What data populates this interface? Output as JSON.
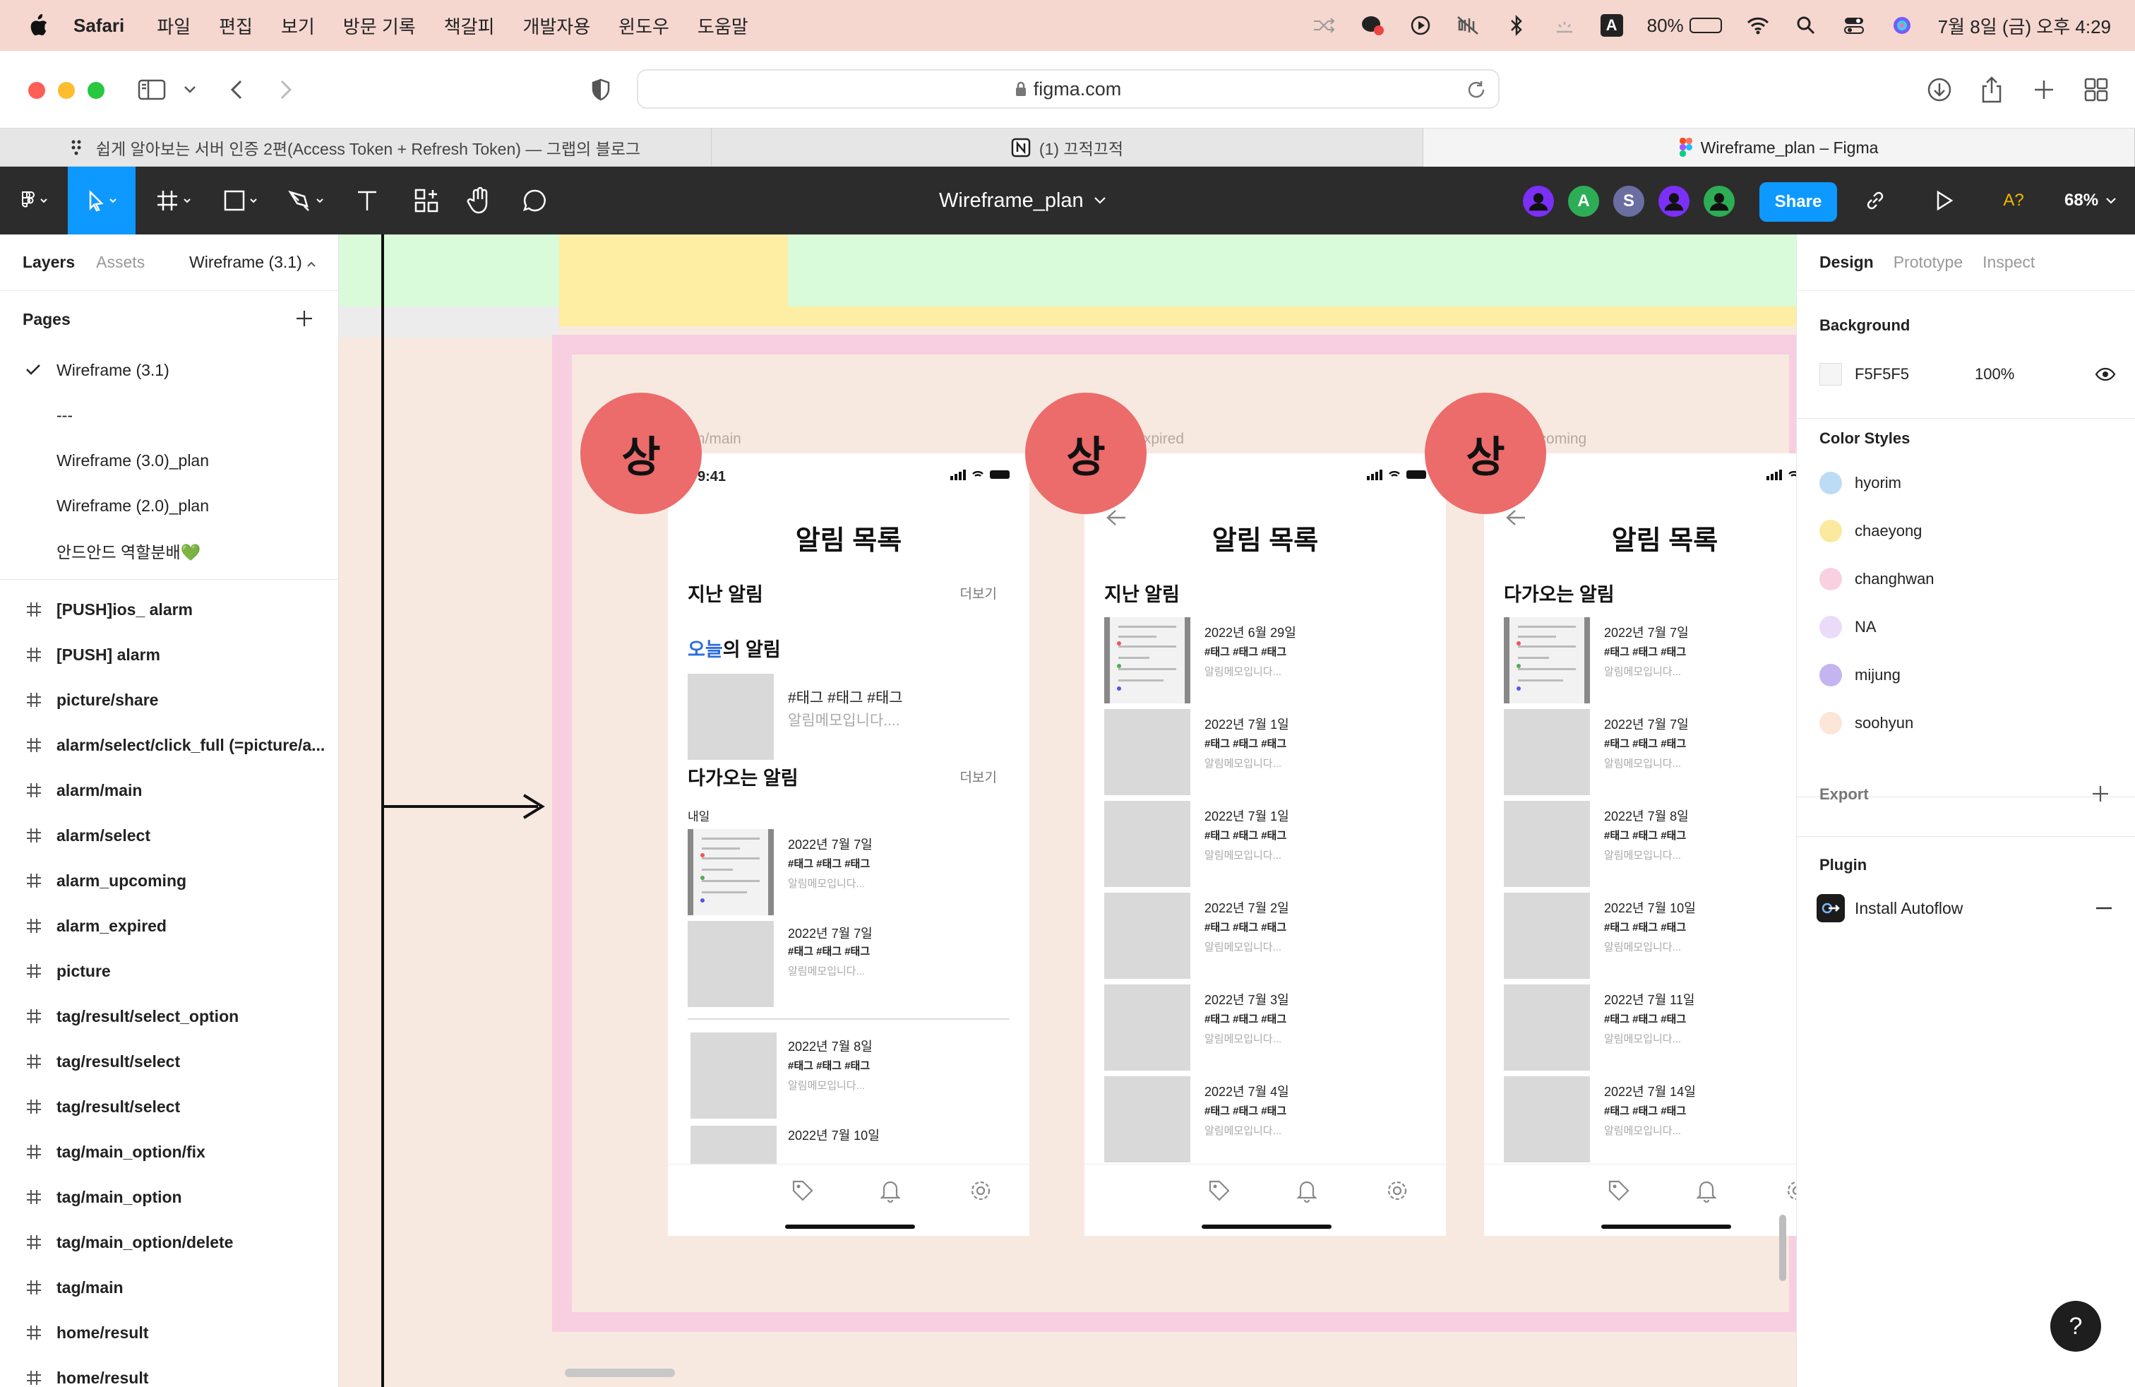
{
  "menubar": {
    "app_name": "Safari",
    "items": [
      "파일",
      "편집",
      "보기",
      "방문 기록",
      "책갈피",
      "개발자용",
      "윈도우",
      "도움말"
    ],
    "battery_percent": "80%",
    "battery_level": 0.8,
    "datetime": "7월 8일 (금) 오후 4:29",
    "input_indicator": "A"
  },
  "safari": {
    "url": "figma.com",
    "tabs": [
      {
        "label": "쉽게 알아보는 서버 인증 2편(Access Token + Refresh Token) — 그랩의 블로그"
      },
      {
        "label": "(1) 끄적끄적"
      },
      {
        "label": "Wireframe_plan – Figma"
      }
    ]
  },
  "figma": {
    "file_title": "Wireframe_plan",
    "avatars": [
      {
        "letter": "",
        "color": "#7b2ff7"
      },
      {
        "letter": "A",
        "color": "#2dad55"
      },
      {
        "letter": "S",
        "color": "#6a6ea0"
      },
      {
        "letter": "",
        "color": "#7b2ff7"
      },
      {
        "letter": "",
        "color": "#2dad55"
      }
    ],
    "share_label": "Share",
    "font_warning": "A?",
    "zoom": "68%"
  },
  "left_panel": {
    "tab_layers": "Layers",
    "tab_assets": "Assets",
    "current_page": "Wireframe (3.1)",
    "pages_title": "Pages",
    "pages": [
      "Wireframe (3.1)",
      "---",
      "Wireframe (3.0)_plan",
      "Wireframe (2.0)_plan",
      "안드안드 역할분배💚"
    ],
    "frames": [
      "[PUSH]ios_ alarm",
      "[PUSH] alarm",
      "picture/share",
      "alarm/select/click_full (=picture/a...",
      "alarm/main",
      "alarm/select",
      "alarm_upcoming",
      "alarm_expired",
      "picture",
      "tag/result/select_option",
      "tag/result/select",
      "tag/result/select",
      "tag/main_option/fix",
      "tag/main_option",
      "tag/main_option/delete",
      "tag/main",
      "home/result",
      "home/result"
    ]
  },
  "canvas": {
    "badge_text": "상",
    "frame_labels": [
      "alarm/main",
      "rm_expired",
      "rm_upcoming"
    ],
    "phones": [
      {
        "status_time": "9:41",
        "title": "알림 목록",
        "past_title": "지난 알림",
        "more_label": "더보기",
        "today_prefix": "오늘",
        "today_suffix": "의 알림",
        "today_tags": "#태그 #태그 #태그",
        "today_memo": "알림메모입니다....",
        "upcoming_title": "다가오는 알림",
        "tomorrow_label": "내일",
        "items": [
          {
            "date": "2022년 7월 7일",
            "tags": "#태그 #태그 #태그",
            "memo": "알림메모입니다..."
          },
          {
            "date": "2022년 7월 7일",
            "tags": "#태그 #태그 #태그",
            "memo": "알림메모입니다..."
          },
          {
            "date": "2022년 7월 8일",
            "tags": "#태그 #태그 #태그",
            "memo": "알림메모입니다..."
          },
          {
            "date": "2022년 7월 10일"
          }
        ]
      },
      {
        "status_time": "1",
        "title": "알림 목록",
        "section_title": "지난 알림",
        "items": [
          {
            "date": "2022년 6월 29일",
            "tags": "#태그 #태그 #태그",
            "memo": "알림메모입니다..."
          },
          {
            "date": "2022년 7월 1일",
            "tags": "#태그 #태그 #태그",
            "memo": "알림메모입니다..."
          },
          {
            "date": "2022년 7월 1일",
            "tags": "#태그 #태그 #태그",
            "memo": "알림메모입니다..."
          },
          {
            "date": "2022년 7월 2일",
            "tags": "#태그 #태그 #태그",
            "memo": "알림메모입니다..."
          },
          {
            "date": "2022년 7월 3일",
            "tags": "#태그 #태그 #태그",
            "memo": "알림메모입니다..."
          },
          {
            "date": "2022년 7월 4일",
            "tags": "#태그 #태그 #태그",
            "memo": "알림메모입니다..."
          }
        ]
      },
      {
        "status_time": "1",
        "title": "알림 목록",
        "section_title": "다가오는 알림",
        "items": [
          {
            "date": "2022년 7월 7일",
            "tags": "#태그 #태그 #태그",
            "memo": "알림메모입니다..."
          },
          {
            "date": "2022년 7월 7일",
            "tags": "#태그 #태그 #태그",
            "memo": "알림메모입니다..."
          },
          {
            "date": "2022년 7월 8일",
            "tags": "#태그 #태그 #태그",
            "memo": "알림메모입니다..."
          },
          {
            "date": "2022년 7월 10일",
            "tags": "#태그 #태그 #태그",
            "memo": "알림메모입니다..."
          },
          {
            "date": "2022년 7월 11일",
            "tags": "#태그 #태그 #태그",
            "memo": "알림메모입니다..."
          },
          {
            "date": "2022년 7월 14일",
            "tags": "#태그 #태그 #태그",
            "memo": "알림메모입니다..."
          }
        ]
      }
    ]
  },
  "right_panel": {
    "tabs": [
      "Design",
      "Prototype",
      "Inspect"
    ],
    "background_title": "Background",
    "background_hex": "F5F5F5",
    "background_opacity": "100%",
    "color_styles_title": "Color Styles",
    "color_styles": [
      {
        "name": "hyorim",
        "color": "#bcdcf5"
      },
      {
        "name": "chaeyong",
        "color": "#fbe9a0"
      },
      {
        "name": "changhwan",
        "color": "#f8d0e0"
      },
      {
        "name": "NA",
        "color": "#eadcf8"
      },
      {
        "name": "mijung",
        "color": "#c4b4f0"
      },
      {
        "name": "soohyun",
        "color": "#fbe6d8"
      }
    ],
    "export_title": "Export",
    "plugin_title": "Plugin",
    "plugin_name": "Install Autoflow",
    "help_label": "?"
  }
}
